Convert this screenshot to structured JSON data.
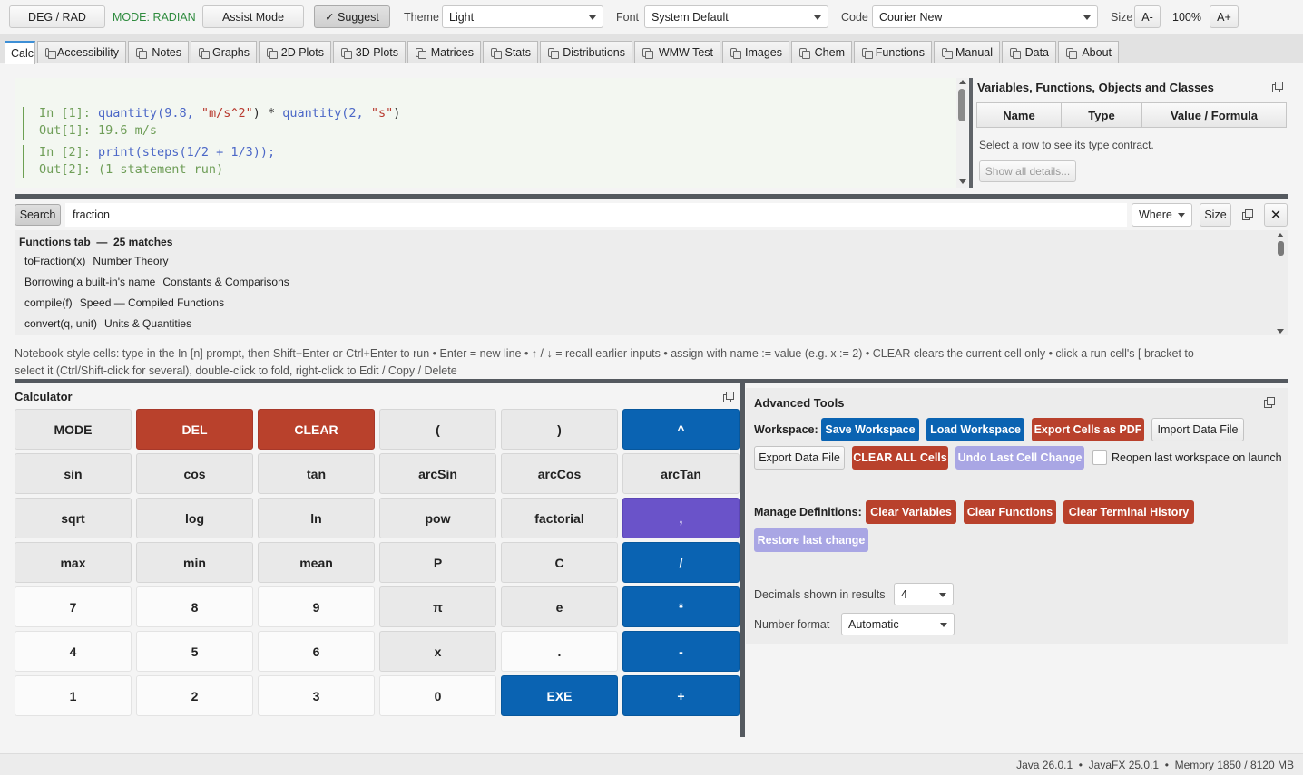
{
  "toolbar": {
    "deg_rad": "DEG / RAD",
    "mode": "MODE: RADIAN",
    "assist": "Assist Mode",
    "suggest": "✓ Suggest",
    "theme_label": "Theme",
    "theme_value": "Light",
    "font_label": "Font",
    "font_value": "System Default",
    "code_label": "Code",
    "code_value": "Courier New",
    "size_label": "Size",
    "size_dec": "A-",
    "zoom": "100%",
    "size_inc": "A+"
  },
  "tabs": [
    "Calc",
    "Accessibility",
    "Notes",
    "Graphs",
    "2D Plots",
    "3D Plots",
    "Matrices",
    "Stats",
    "Distributions",
    "WMW Test",
    "Images",
    "Chem",
    "Functions",
    "Manual",
    "Data",
    "About"
  ],
  "notebook": {
    "in1_prompt": "In [1]: ",
    "in1_a": "quantity",
    "in1_b": "(9.8, ",
    "in1_c": "\"m/s^2\"",
    "in1_d": ") * ",
    "in1_e": "quantity",
    "in1_f": "(2, ",
    "in1_g": "\"s\"",
    "in1_h": ")",
    "out1": "Out[1]: 19.6 m/s",
    "in2_prompt": "In [2]: ",
    "in2_a": "print",
    "in2_b": "(steps(1/2 + 1/3));",
    "out2": "Out[2]: (1 statement run)"
  },
  "vars": {
    "title": "Variables, Functions, Objects and Classes",
    "col_name": "Name",
    "col_type": "Type",
    "col_value": "Value / Formula",
    "hint": "Select a row to see its type contract.",
    "details": "Show all details..."
  },
  "search": {
    "button": "Search",
    "query": "fraction",
    "where": "Where",
    "size": "Size",
    "heading": "Functions tab  —  25 matches",
    "results": [
      {
        "name": "toFraction(x)",
        "category": "Number Theory"
      },
      {
        "name": "Borrowing a built-in's name",
        "category": "Constants & Comparisons"
      },
      {
        "name": "compile(f)",
        "category": "Speed — Compiled Functions"
      },
      {
        "name": "convert(q, unit)",
        "category": "Units & Quantities"
      }
    ]
  },
  "help_line1": "Notebook-style cells: type in the In [n] prompt, then Shift+Enter or Ctrl+Enter to run  •  Enter = new line  •  ↑ / ↓ = recall earlier inputs  •  assign with  name := value  (e.g. x := 2)  •  CLEAR clears the current cell only  •  click a run cell's [ bracket to",
  "help_line2": "select it (Ctrl/Shift-click for several), double-click to fold, right-click to Edit / Copy / Delete",
  "calculator": {
    "title": "Calculator",
    "keys": [
      [
        "MODE",
        "DEL",
        "CLEAR",
        "(",
        ")",
        "^"
      ],
      [
        "sin",
        "cos",
        "tan",
        "arcSin",
        "arcCos",
        "arcTan"
      ],
      [
        "sqrt",
        "log",
        "ln",
        "pow",
        "factorial",
        ","
      ],
      [
        "max",
        "min",
        "mean",
        "P",
        "C",
        "/"
      ],
      [
        "7",
        "8",
        "9",
        "π",
        "e",
        "*"
      ],
      [
        "4",
        "5",
        "6",
        "x",
        ".",
        "-"
      ],
      [
        "1",
        "2",
        "3",
        "0",
        "EXE",
        "+"
      ]
    ]
  },
  "advanced": {
    "title": "Advanced Tools",
    "workspace_label": "Workspace:",
    "save": "Save Workspace",
    "load": "Load Workspace",
    "export_pdf": "Export Cells as PDF",
    "import_data": "Import Data File",
    "export_data": "Export Data File",
    "clear_all": "CLEAR ALL Cells",
    "undo": "Undo Last Cell Change",
    "reopen": "Reopen last workspace on launch",
    "manage_label": "Manage Definitions:",
    "clear_vars": "Clear Variables",
    "clear_funcs": "Clear Functions",
    "clear_history": "Clear Terminal History",
    "restore": "Restore last change",
    "decimals_label": "Decimals shown in results",
    "decimals_value": "4",
    "format_label": "Number format",
    "format_value": "Automatic"
  },
  "status": "Java 26.0.1  •  JavaFX 25.0.1  •  Memory 1850 / 8120 MB"
}
